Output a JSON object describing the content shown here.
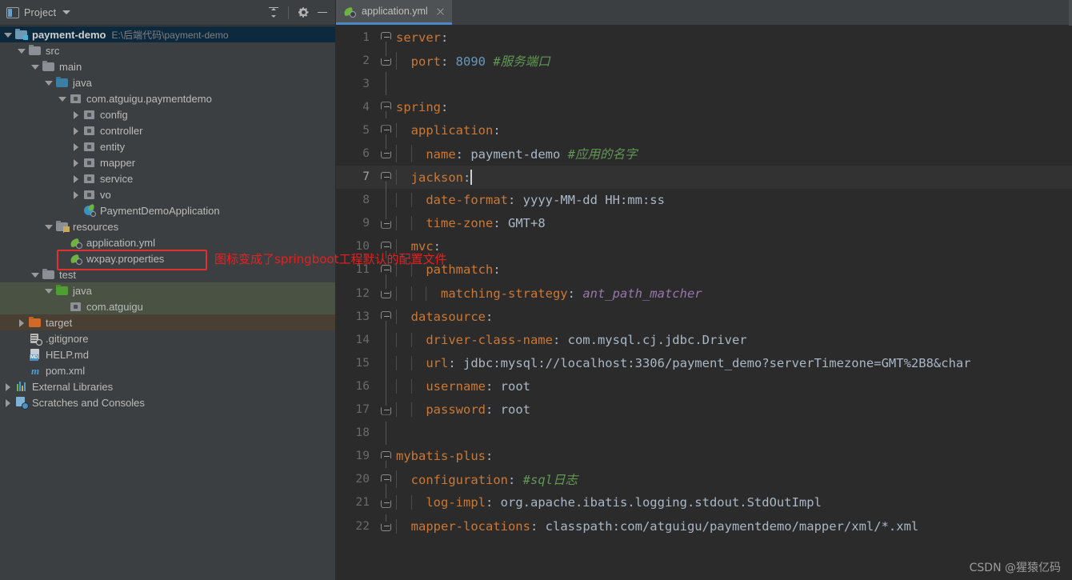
{
  "panel": {
    "title": "Project",
    "window_icon": "project-window-icon",
    "dropdown_icon": "chevron-down-icon",
    "buttons": [
      {
        "name": "collapse-all-button",
        "icon": "collapse-all-icon",
        "tooltip": "Collapse All"
      },
      {
        "name": "settings-button",
        "icon": "gear-icon",
        "tooltip": "Settings"
      },
      {
        "name": "hide-button",
        "icon": "minus-icon",
        "tooltip": "Hide"
      }
    ]
  },
  "tree": [
    {
      "label": "payment-demo",
      "path": "E:\\后端代码\\payment-demo",
      "indent": 0,
      "arrow": "down",
      "icon": "module-folder-icon",
      "style": "selected",
      "bold": true
    },
    {
      "label": "src",
      "indent": 1,
      "arrow": "down",
      "icon": "folder-grey-icon"
    },
    {
      "label": "main",
      "indent": 2,
      "arrow": "down",
      "icon": "folder-grey-icon"
    },
    {
      "label": "java",
      "indent": 3,
      "arrow": "down",
      "icon": "folder-blue-icon"
    },
    {
      "label": "com.atguigu.paymentdemo",
      "indent": 4,
      "arrow": "down",
      "icon": "package-icon"
    },
    {
      "label": "config",
      "indent": 5,
      "arrow": "right",
      "icon": "package-icon"
    },
    {
      "label": "controller",
      "indent": 5,
      "arrow": "right",
      "icon": "package-icon"
    },
    {
      "label": "entity",
      "indent": 5,
      "arrow": "right",
      "icon": "package-icon"
    },
    {
      "label": "mapper",
      "indent": 5,
      "arrow": "right",
      "icon": "package-icon"
    },
    {
      "label": "service",
      "indent": 5,
      "arrow": "right",
      "icon": "package-icon"
    },
    {
      "label": "vo",
      "indent": 5,
      "arrow": "right",
      "icon": "package-icon"
    },
    {
      "label": "PaymentDemoApplication",
      "indent": 5,
      "arrow": "none",
      "icon": "spring-boot-class-icon"
    },
    {
      "label": "resources",
      "indent": 3,
      "arrow": "down",
      "icon": "resources-folder-icon"
    },
    {
      "label": "application.yml",
      "indent": 4,
      "arrow": "none",
      "icon": "spring-config-icon"
    },
    {
      "label": "wxpay.properties",
      "indent": 4,
      "arrow": "none",
      "icon": "spring-config-icon",
      "boxed": true
    },
    {
      "label": "test",
      "indent": 2,
      "arrow": "down",
      "icon": "folder-grey-icon"
    },
    {
      "label": "java",
      "indent": 3,
      "arrow": "down",
      "icon": "folder-green-icon",
      "style": "highlight-green"
    },
    {
      "label": "com.atguigu",
      "indent": 4,
      "arrow": "none",
      "icon": "package-icon",
      "style": "highlight-green"
    },
    {
      "label": "target",
      "indent": 1,
      "arrow": "right",
      "icon": "folder-orange-icon",
      "style": "highlight-brown"
    },
    {
      "label": ".gitignore",
      "indent": 1,
      "arrow": "none",
      "icon": "gitignore-icon"
    },
    {
      "label": "HELP.md",
      "indent": 1,
      "arrow": "none",
      "icon": "markdown-icon"
    },
    {
      "label": "pom.xml",
      "indent": 1,
      "arrow": "none",
      "icon": "maven-icon"
    },
    {
      "label": "External Libraries",
      "indent": 0,
      "arrow": "right",
      "icon": "libraries-icon"
    },
    {
      "label": "Scratches and Consoles",
      "indent": 0,
      "arrow": "right",
      "icon": "scratches-icon"
    }
  ],
  "annotation": {
    "text": "图标变成了springboot工程默认的配置文件",
    "color": "#e62020",
    "box_target": "wxpay.properties"
  },
  "editor": {
    "tab": {
      "label": "application.yml",
      "icon": "spring-config-icon",
      "close_icon": "close-icon",
      "active": true
    },
    "lines": [
      {
        "n": "1",
        "fold": "top",
        "guides": 0,
        "segs": [
          {
            "t": "server",
            ":": true,
            "c": "k"
          },
          {
            "t": ":",
            "c": "p"
          }
        ]
      },
      {
        "n": "2",
        "fold": "bot",
        "guides": 1,
        "segs": [
          {
            "t": "  port",
            "c": "k"
          },
          {
            "t": ": ",
            "c": "p"
          },
          {
            "t": "8090",
            "c": "num"
          },
          {
            "t": " ",
            "c": "v"
          },
          {
            "t": "#服务端口",
            "c": "cmt"
          }
        ]
      },
      {
        "n": "3",
        "fold": "none",
        "guides": 0,
        "segs": []
      },
      {
        "n": "4",
        "fold": "top",
        "guides": 0,
        "segs": [
          {
            "t": "spring",
            "c": "k"
          },
          {
            "t": ":",
            "c": "p"
          }
        ]
      },
      {
        "n": "5",
        "fold": "top",
        "guides": 1,
        "segs": [
          {
            "t": "  application",
            "c": "k"
          },
          {
            "t": ":",
            "c": "p"
          }
        ]
      },
      {
        "n": "6",
        "fold": "bot",
        "guides": 2,
        "segs": [
          {
            "t": "    name",
            "c": "k"
          },
          {
            "t": ": ",
            "c": "p"
          },
          {
            "t": "payment-demo",
            "c": "v"
          },
          {
            "t": " ",
            "c": "v"
          },
          {
            "t": "#应用的名字",
            "c": "cmt"
          }
        ]
      },
      {
        "n": "7",
        "fold": "top",
        "guides": 1,
        "current": true,
        "caret": true,
        "segs": [
          {
            "t": "  jackson",
            "c": "k"
          },
          {
            "t": ":",
            "c": "p"
          }
        ]
      },
      {
        "n": "8",
        "fold": "none",
        "guides": 2,
        "segs": [
          {
            "t": "    date-format",
            "c": "k"
          },
          {
            "t": ": ",
            "c": "p"
          },
          {
            "t": "yyyy-MM-dd HH:mm:ss",
            "c": "v"
          }
        ]
      },
      {
        "n": "9",
        "fold": "bot",
        "guides": 2,
        "segs": [
          {
            "t": "    time-zone",
            "c": "k"
          },
          {
            "t": ": ",
            "c": "p"
          },
          {
            "t": "GMT+8",
            "c": "v"
          }
        ]
      },
      {
        "n": "10",
        "fold": "top",
        "guides": 1,
        "segs": [
          {
            "t": "  mvc",
            "c": "k"
          },
          {
            "t": ":",
            "c": "p"
          }
        ]
      },
      {
        "n": "11",
        "fold": "top",
        "guides": 2,
        "segs": [
          {
            "t": "    pathmatch",
            "c": "k"
          },
          {
            "t": ":",
            "c": "p"
          }
        ]
      },
      {
        "n": "12",
        "fold": "bot",
        "guides": 3,
        "segs": [
          {
            "t": "      matching-strategy",
            "c": "k"
          },
          {
            "t": ": ",
            "c": "p"
          },
          {
            "t": "ant_path_matcher",
            "c": "ita"
          }
        ]
      },
      {
        "n": "13",
        "fold": "top",
        "guides": 1,
        "segs": [
          {
            "t": "  datasource",
            "c": "k"
          },
          {
            "t": ":",
            "c": "p"
          }
        ]
      },
      {
        "n": "14",
        "fold": "none",
        "guides": 2,
        "segs": [
          {
            "t": "    driver-class-name",
            "c": "k"
          },
          {
            "t": ": ",
            "c": "p"
          },
          {
            "t": "com.mysql.cj.jdbc.Driver",
            "c": "v"
          }
        ]
      },
      {
        "n": "15",
        "fold": "none",
        "guides": 2,
        "segs": [
          {
            "t": "    url",
            "c": "k"
          },
          {
            "t": ": ",
            "c": "p"
          },
          {
            "t": "jdbc:mysql://localhost:3306/payment_demo?serverTimezone=GMT%2B8&char",
            "c": "v"
          }
        ]
      },
      {
        "n": "16",
        "fold": "none",
        "guides": 2,
        "segs": [
          {
            "t": "    username",
            "c": "k"
          },
          {
            "t": ": ",
            "c": "p"
          },
          {
            "t": "root",
            "c": "v"
          }
        ]
      },
      {
        "n": "17",
        "fold": "bot",
        "guides": 2,
        "segs": [
          {
            "t": "    password",
            "c": "k"
          },
          {
            "t": ": ",
            "c": "p"
          },
          {
            "t": "root",
            "c": "v"
          }
        ]
      },
      {
        "n": "18",
        "fold": "none",
        "guides": 0,
        "segs": []
      },
      {
        "n": "19",
        "fold": "top",
        "guides": 0,
        "segs": [
          {
            "t": "mybatis-plus",
            "c": "k"
          },
          {
            "t": ":",
            "c": "p"
          }
        ]
      },
      {
        "n": "20",
        "fold": "top",
        "guides": 1,
        "segs": [
          {
            "t": "  configuration",
            "c": "k"
          },
          {
            "t": ": ",
            "c": "p"
          },
          {
            "t": "#sql日志",
            "c": "cmt"
          }
        ]
      },
      {
        "n": "21",
        "fold": "bot",
        "guides": 2,
        "segs": [
          {
            "t": "    log-impl",
            "c": "k"
          },
          {
            "t": ": ",
            "c": "p"
          },
          {
            "t": "org.apache.ibatis.logging.stdout.StdOutImpl",
            "c": "v"
          }
        ]
      },
      {
        "n": "22",
        "fold": "bot",
        "guides": 1,
        "segs": [
          {
            "t": "  mapper-locations",
            "c": "k"
          },
          {
            "t": ": ",
            "c": "p"
          },
          {
            "t": "classpath:com/atguigu/paymentdemo/mapper/xml/*.xml",
            "c": "v"
          }
        ]
      }
    ]
  },
  "watermark": "CSDN @猩猿亿码",
  "colors": {
    "panel_bg": "#3c3f41",
    "editor_bg": "#2b2b2b",
    "selection_blue": "#0d293e",
    "highlight_green": "#495243",
    "highlight_brown": "#4a3f33",
    "tab_underline": "#4a88c7",
    "key_orange": "#cc7832",
    "value_grey": "#a9b7c6",
    "number_blue": "#6897bb",
    "comment_green": "#629755",
    "italic_purple": "#9876aa",
    "annotation_red": "#e62020"
  }
}
